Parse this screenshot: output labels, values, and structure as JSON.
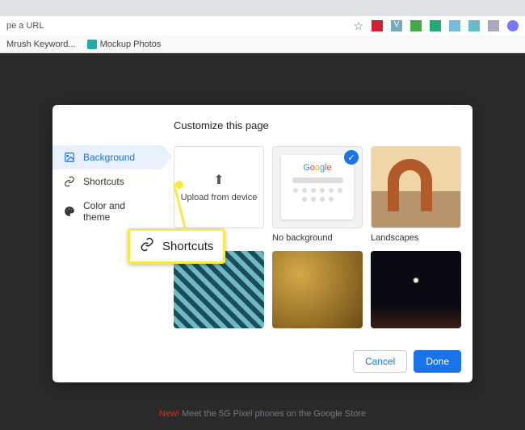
{
  "chrome": {
    "address_placeholder": "pe a URL",
    "bookmarks": [
      {
        "label": "Mrush Keyword..."
      },
      {
        "label": "Mockup Photos"
      }
    ]
  },
  "dialog": {
    "title": "Customize this page",
    "sidebar": [
      {
        "id": "background",
        "label": "Background",
        "active": true
      },
      {
        "id": "shortcuts",
        "label": "Shortcuts",
        "active": false
      },
      {
        "id": "color",
        "label": "Color and theme",
        "active": false
      }
    ],
    "tiles": {
      "upload_label": "Upload from device",
      "nobg_label": "No background",
      "landscapes_label": "Landscapes"
    },
    "buttons": {
      "cancel": "Cancel",
      "done": "Done"
    }
  },
  "callout": {
    "label": "Shortcuts"
  },
  "promo": {
    "new_label": "New!",
    "text": " Meet the 5G Pixel phones on the Google Store"
  }
}
